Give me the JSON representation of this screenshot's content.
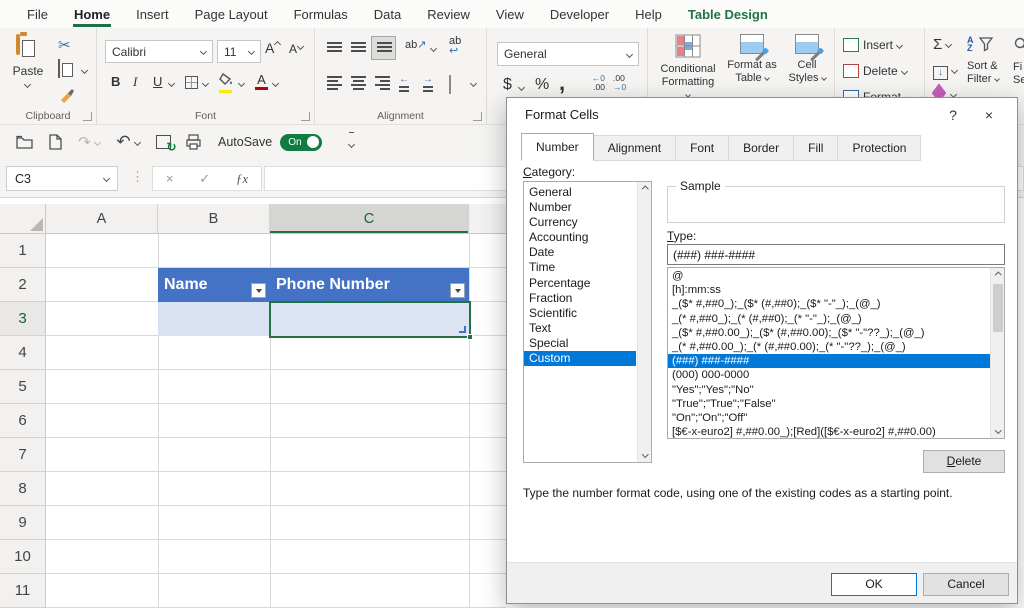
{
  "colors": {
    "accent_green": "#217346",
    "table_header_blue": "#4472C4",
    "banded_row_blue": "#D9E2F3",
    "selection_blue": "#0078D7"
  },
  "tabs": {
    "items": [
      "File",
      "Home",
      "Insert",
      "Page Layout",
      "Formulas",
      "Data",
      "Review",
      "View",
      "Developer",
      "Help",
      "Table Design"
    ],
    "active": "Home"
  },
  "icons": {
    "cut": "✂",
    "undo": "↶",
    "redo": "↷",
    "sync": "↻",
    "sum": "Σ",
    "check": "✓",
    "x": "×",
    "fx": "ƒx",
    "dots": "⋮",
    "wrap_arrow": "↩",
    "orient_arrow": "↗",
    "comma": ",",
    "help": "?",
    "close": "×",
    "eraser": "◆",
    "fill_down": "↓",
    "indent_left": "←",
    "indent_right": "→"
  },
  "ribbon": {
    "clipboard": {
      "group_label": "Clipboard",
      "paste_label": "Paste"
    },
    "font": {
      "group_label": "Font",
      "font_name": "Calibri",
      "font_size": "11",
      "bold": "B",
      "italic": "I",
      "underline": "U",
      "a_big": "A",
      "a_small": "A",
      "a_color": "A"
    },
    "alignment": {
      "group_label": "Alignment",
      "ab": "ab"
    },
    "number": {
      "format": "General",
      "currency": "$",
      "percent": "%",
      "inc_top": "←0",
      "inc_bottom": ".00",
      "dec_top": ".00",
      "dec_bottom": "→0"
    },
    "styles": {
      "cond1": "Conditional",
      "cond2": "Formatting",
      "fat1": "Format as",
      "fat2": "Table",
      "cs1": "Cell",
      "cs2": "Styles"
    },
    "cells": {
      "insert": "Insert",
      "delete": "Delete",
      "format": "Format"
    },
    "editing": {
      "sort_a": "A",
      "sort_z": "Z",
      "sort1": "Sort &",
      "sort2": "Filter",
      "find1": "Fi",
      "find2": "Sel"
    }
  },
  "qat": {
    "autosave_label": "AutoSave",
    "autosave_state": "On"
  },
  "formula_bar": {
    "name_box": "C3",
    "formula": ""
  },
  "grid": {
    "columns": [
      "A",
      "B",
      "C"
    ],
    "rows": [
      "1",
      "2",
      "3",
      "4",
      "5",
      "6",
      "7",
      "8",
      "9",
      "10",
      "11"
    ],
    "table_headers": [
      "Name",
      "Phone Number"
    ],
    "selected_cell": "C3"
  },
  "dialog": {
    "title": "Format Cells",
    "tabs": [
      "Number",
      "Alignment",
      "Font",
      "Border",
      "Fill",
      "Protection"
    ],
    "active_tab": "Number",
    "category_first": "C",
    "category_rest": "ategory:",
    "categories": [
      "General",
      "Number",
      "Currency",
      "Accounting",
      "Date",
      "Time",
      "Percentage",
      "Fraction",
      "Scientific",
      "Text",
      "Special",
      "Custom"
    ],
    "selected_category": "Custom",
    "sample_label": "Sample",
    "type_first": "T",
    "type_rest": "ype:",
    "type_value": "(###) ###-####",
    "codes": [
      "@",
      "[h]:mm:ss",
      "_($* #,##0_);_($* (#,##0);_($* \"-\"_);_(@_)",
      "_(* #,##0_);_(* (#,##0);_(* \"-\"_);_(@_)",
      "_($* #,##0.00_);_($* (#,##0.00);_($* \"-\"??_);_(@_)",
      "_(* #,##0.00_);_(* (#,##0.00);_(* \"-\"??_);_(@_)",
      "(###) ###-####",
      "(000) 000-0000",
      "\"Yes\";\"Yes\";\"No\"",
      "\"True\";\"True\";\"False\"",
      "\"On\";\"On\";\"Off\"",
      "[$€-x-euro2] #,##0.00_);[Red]([$€-x-euro2] #,##0.00)"
    ],
    "selected_code": "(###) ###-####",
    "delete_first": "D",
    "delete_rest": "elete",
    "helper_text": "Type the number format code, using one of the existing codes as a starting point.",
    "ok_label": "OK",
    "cancel_label": "Cancel"
  }
}
